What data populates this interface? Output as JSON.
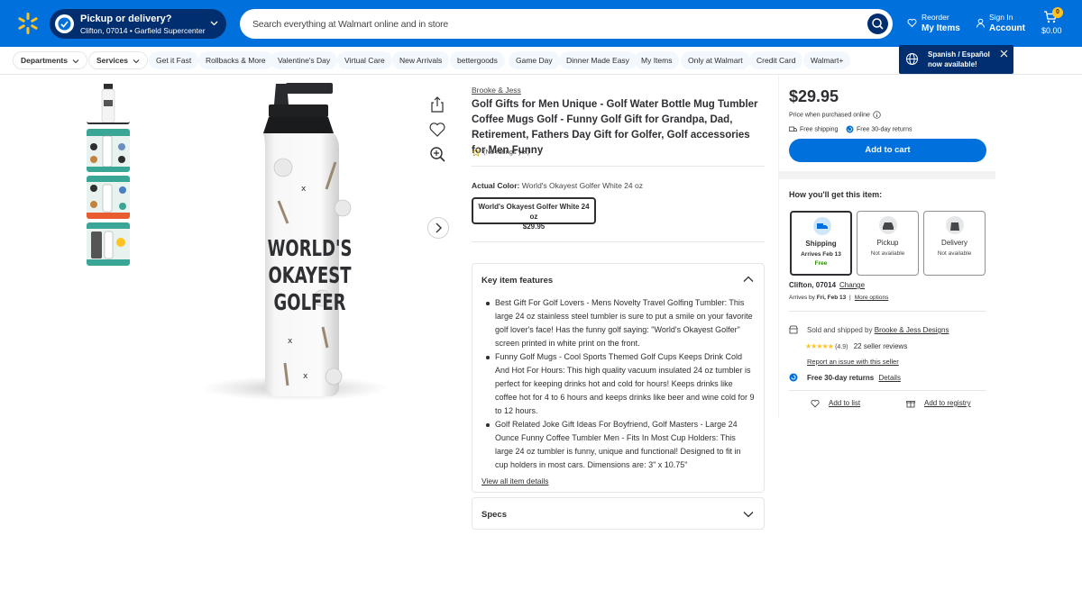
{
  "header": {
    "pickup_title": "Pickup or delivery?",
    "pickup_location": "Clifton, 07014 • Garfield Supercenter",
    "search_placeholder": "Search everything at Walmart online and in store",
    "reorder_top": "Reorder",
    "reorder_bottom": "My Items",
    "signin_top": "Sign In",
    "signin_bottom": "Account",
    "cart_count": "0",
    "cart_total": "$0.00"
  },
  "nav": {
    "departments": "Departments",
    "services": "Services",
    "links": [
      "Get it Fast",
      "Rollbacks & More",
      "Valentine's Day",
      "Virtual Care",
      "New Arrivals",
      "bettergoods",
      "Game Day",
      "Dinner Made Easy",
      "My Items",
      "Only at Walmart",
      "Credit Card",
      "Walmart+"
    ]
  },
  "language_banner": {
    "text": "Spanish / Español now available!"
  },
  "product": {
    "brand": "Brooke & Jess",
    "title": "Golf Gifts for Men Unique - Golf Water Bottle Mug Tumbler Coffee Mugs Golf - Funny Golf Gift for Grandpa, Dad, Retirement, Fathers Day Gift for Golfer, Golf accessories for Men Funny",
    "rating_text": "(No ratings yet)",
    "color_label": "Actual Color:",
    "color_value": "World's Okayest Golfer White 24 oz",
    "variant_name": "World's Okayest Golfer White 24 oz",
    "variant_price": "$29.95",
    "bottle_text": [
      "WORLD'S",
      "OKAYEST",
      "GOLFER"
    ]
  },
  "features": {
    "title": "Key item features",
    "items": [
      "Best Gift For Golf Lovers - Mens Novelty Travel Golfing Tumbler: This large 24 oz stainless steel tumbler is sure to put a smile on your favorite golf lover's face! Has the funny golf saying: \"World's Okayest Golfer\" screen printed in white print on the front.",
      "Funny Golf Mugs - Cool Sports Themed Golf Cups Keeps Drink Cold And Hot For Hours: This high quality vacuum insulated 24 oz tumbler is perfect for keeping drinks hot and cold for hours! Keeps drinks like coffee hot for 4 to 6 hours and keeps drinks like beer and wine cold for 9 to 12 hours.",
      "Golf Related Joke Gift Ideas For Boyfriend, Golf Masters - Large 24 Ounce Funny Coffee Tumbler Men - Fits In Most Cup Holders: This large 24 oz tumbler is funny, unique and functional! Designed to fit in cup holders in most cars. Dimensions are: 3\" x 10.75\""
    ],
    "view_all": "View all item details"
  },
  "specs": {
    "title": "Specs"
  },
  "buybox": {
    "price": "$29.95",
    "price_when_purchased": "Price when purchased online",
    "free_shipping": "Free shipping",
    "free_returns": "Free 30-day returns",
    "add_to_cart": "Add to cart",
    "how_get": "How you'll get this item:",
    "options": [
      {
        "title": "Shipping",
        "line1": "Arrives Feb 13",
        "line2": "Free"
      },
      {
        "title": "Pickup",
        "line1": "Not available",
        "line2": ""
      },
      {
        "title": "Delivery",
        "line1": "Not available",
        "line2": ""
      }
    ],
    "location": "Clifton, 07014",
    "change": "Change",
    "arrives_by": "Arrives by",
    "arrives_date": "Fri, Feb 13",
    "more_options": "More options",
    "sold_by_prefix": "Sold and shipped by",
    "seller": "Brooke & Jess Designs",
    "seller_rating": "(4.9)",
    "seller_reviews": "22 seller reviews",
    "report_issue": "Report an issue with this seller",
    "returns_bold": "Free 30-day returns",
    "returns_details": "Details",
    "add_to_list": "Add to list",
    "add_to_registry": "Add to registry"
  },
  "colors": {
    "primary_blue": "#0071dc",
    "dark_blue": "#002e6e",
    "yellow": "#ffc220",
    "green": "#2a8703"
  }
}
